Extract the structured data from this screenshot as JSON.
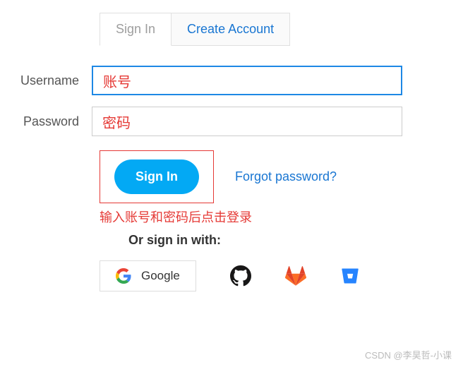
{
  "tabs": {
    "signin": "Sign In",
    "create": "Create Account"
  },
  "fields": {
    "username_label": "Username",
    "username_value": "账号",
    "password_label": "Password",
    "password_value": "密码"
  },
  "actions": {
    "signin_button": "Sign In",
    "forgot": "Forgot password?"
  },
  "annotation": "输入账号和密码后点击登录",
  "or_label": "Or sign in with:",
  "providers": {
    "google": "Google"
  },
  "watermark": "CSDN @李昊哲-小课"
}
